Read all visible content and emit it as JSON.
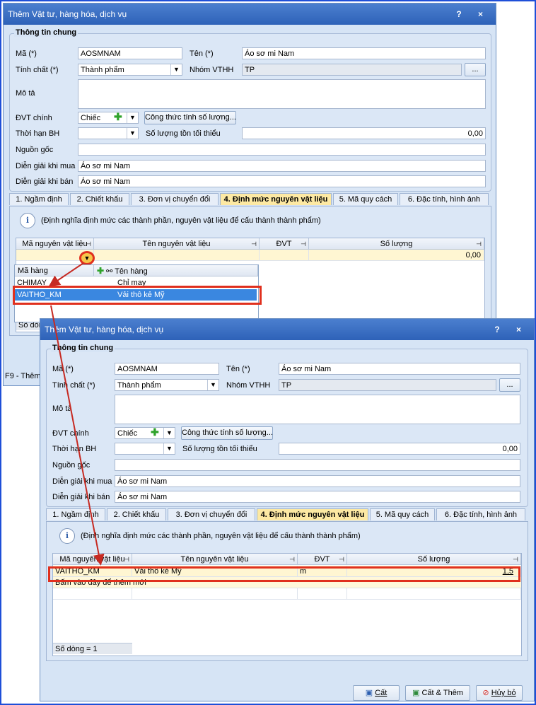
{
  "window_back": {
    "title": "Thêm Vật tư, hàng hóa, dịch vụ",
    "title_buttons": "? ×",
    "group_title": "Thông tin chung",
    "labels": {
      "ma": "Mã (*)",
      "ten": "Tên (*)",
      "tinh_chat": "Tính chất (*)",
      "nhom": "Nhóm VTHH",
      "mo_ta": "Mô tả",
      "dvt": "ĐVT chính",
      "thoi_han": "Thời hạn BH",
      "so_luong_ton": "Số lượng tồn tối thiểu",
      "nguon_goc": "Nguồn gốc",
      "dg_mua": "Diễn giải khi mua",
      "dg_ban": "Diễn giải khi bán"
    },
    "values": {
      "ma": "AOSMNAM",
      "ten": "Áo sơ mi Nam",
      "tinh_chat": "Thành phẩm",
      "nhom": "TP",
      "mo_ta": "",
      "dvt": "Chiếc",
      "thoi_han": "",
      "so_luong_ton": "0,00",
      "nguon_goc": "",
      "dg_mua": "Áo sơ mi Nam",
      "dg_ban": "Áo sơ mi Nam"
    },
    "ellipsis_button": "...",
    "formula_button": "Công thức tính số lượng...",
    "tabs": [
      "1. Ngầm định",
      "2. Chiết khấu",
      "3. Đơn vị chuyển đổi",
      "4. Định mức nguyên vật liệu",
      "5. Mã quy cách",
      "6. Đặc tính, hình ảnh"
    ],
    "info_text": "(Định nghĩa định mức các thành phần, nguyên vật liệu để cấu thành thành phẩm)",
    "grid_headers": [
      "Mã nguyên vật liệu",
      "Tên nguyên vật liệu",
      "ĐVT",
      "Số lượng"
    ],
    "grid_row_qty": "0,00",
    "popup_headers": [
      "Mã hàng",
      "Tên hàng"
    ],
    "popup_rows": [
      {
        "code": "CHIMAY",
        "name": "Chỉ may"
      },
      {
        "code": "VAITHO_KM",
        "name": "Vải thô kẻ Mỹ"
      }
    ],
    "row_count_partial": "Số dòn",
    "f9_partial": "F9 - Thêm"
  },
  "window_front": {
    "title": "Thêm Vật tư, hàng hóa, dịch vụ",
    "title_buttons": "? ×",
    "group_title": "Thông tin chung",
    "labels": {
      "ma": "Mã (*)",
      "ten": "Tên (*)",
      "tinh_chat": "Tính chất (*)",
      "nhom": "Nhóm VTHH",
      "mo_ta": "Mô tả",
      "dvt": "ĐVT chính",
      "thoi_han": "Thời hạn BH",
      "so_luong_ton": "Số lượng tồn tối thiểu",
      "nguon_goc": "Nguồn gốc",
      "dg_mua": "Diễn giải khi mua",
      "dg_ban": "Diễn giải khi bán"
    },
    "values": {
      "ma": "AOSMNAM",
      "ten": "Áo sơ mi Nam",
      "tinh_chat": "Thành phẩm",
      "nhom": "TP",
      "mo_ta": "",
      "dvt": "Chiếc",
      "thoi_han": "",
      "so_luong_ton": "0,00",
      "nguon_goc": "",
      "dg_mua": "Áo sơ mi Nam",
      "dg_ban": "Áo sơ mi Nam"
    },
    "ellipsis_button": "...",
    "formula_button": "Công thức tính số lượng...",
    "tabs": [
      "1. Ngầm định",
      "2. Chiết khấu",
      "3. Đơn vị chuyển đổi",
      "4. Định mức nguyên vật liệu",
      "5. Mã quy cách",
      "6. Đặc tính, hình ảnh"
    ],
    "info_text": "(Định nghĩa định mức các thành phần, nguyên vật liệu để cấu thành thành phẩm)",
    "grid_headers": [
      "Mã nguyên vật liệu",
      "Tên nguyên vật liệu",
      "ĐVT",
      "Số lượng"
    ],
    "grid_row": {
      "code": "VAITHO_KM",
      "name": "Vải thô kẻ Mỹ",
      "unit": "m",
      "qty": "1,5"
    },
    "add_row_hint": "Bấm vào đây để thêm mới",
    "row_count": "Số dòng = 1",
    "buttons": {
      "save": "Cất",
      "save_add": "Cất & Thêm",
      "cancel": "Hủy bỏ"
    }
  },
  "colors": {
    "highlight_red": "#e0301e",
    "active_tab": "#fde9a3",
    "frame_blue": "#1e4fd8",
    "title_blue": "#2e62b8"
  }
}
